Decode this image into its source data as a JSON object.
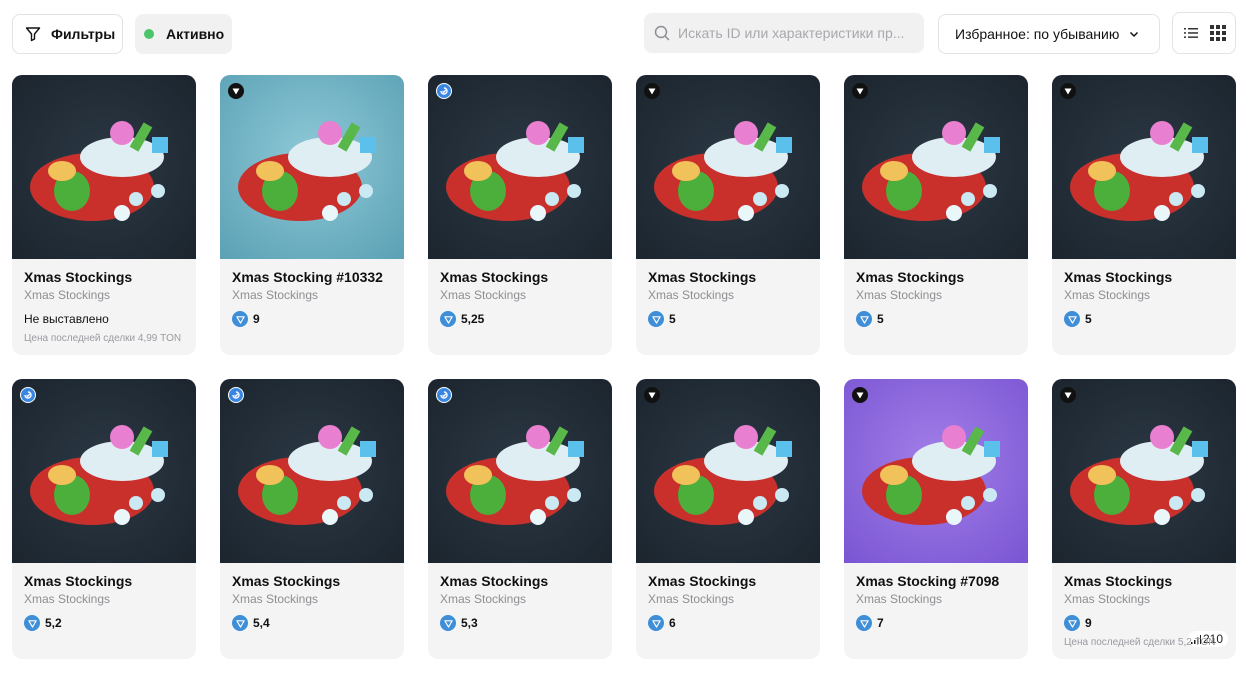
{
  "toolbar": {
    "filters_label": "Фильтры",
    "active_label": "Активно",
    "search_placeholder": "Искать ID или характеристики пр...",
    "sort_label": "Избранное: по убыванию"
  },
  "colors": {
    "accent_green": "#4cc46a",
    "ton_blue": "#3e8fd8"
  },
  "cards": [
    {
      "title": "Xmas Stockings",
      "collection": "Xmas Stockings",
      "status": "Не выставлено",
      "last_deal": "Цена последней сделки 4,99 TON",
      "bg": "dark",
      "badge": ""
    },
    {
      "title": "Xmas Stocking #10332",
      "collection": "Xmas Stockings",
      "price": "9",
      "bg": "teal",
      "badge": "black"
    },
    {
      "title": "Xmas Stockings",
      "collection": "Xmas Stockings",
      "price": "5,25",
      "bg": "dark",
      "badge": "blue"
    },
    {
      "title": "Xmas Stockings",
      "collection": "Xmas Stockings",
      "price": "5",
      "bg": "dark",
      "badge": "black"
    },
    {
      "title": "Xmas Stockings",
      "collection": "Xmas Stockings",
      "price": "5",
      "bg": "dark",
      "badge": "black"
    },
    {
      "title": "Xmas Stockings",
      "collection": "Xmas Stockings",
      "price": "5",
      "bg": "dark",
      "badge": "black"
    },
    {
      "title": "Xmas Stockings",
      "collection": "Xmas Stockings",
      "price": "5,2",
      "bg": "dark",
      "badge": "blue"
    },
    {
      "title": "Xmas Stockings",
      "collection": "Xmas Stockings",
      "price": "5,4",
      "bg": "dark",
      "badge": "blue"
    },
    {
      "title": "Xmas Stockings",
      "collection": "Xmas Stockings",
      "price": "5,3",
      "bg": "dark",
      "badge": "blue"
    },
    {
      "title": "Xmas Stockings",
      "collection": "Xmas Stockings",
      "price": "6",
      "bg": "dark",
      "badge": "black"
    },
    {
      "title": "Xmas Stocking #7098",
      "collection": "Xmas Stockings",
      "price": "7",
      "bg": "purple",
      "badge": "black"
    },
    {
      "title": "Xmas Stockings",
      "collection": "Xmas Stockings",
      "price": "9",
      "last_deal": "Цена последней сделки 5,2 TON",
      "bg": "dark",
      "badge": "black",
      "views": "210"
    }
  ]
}
